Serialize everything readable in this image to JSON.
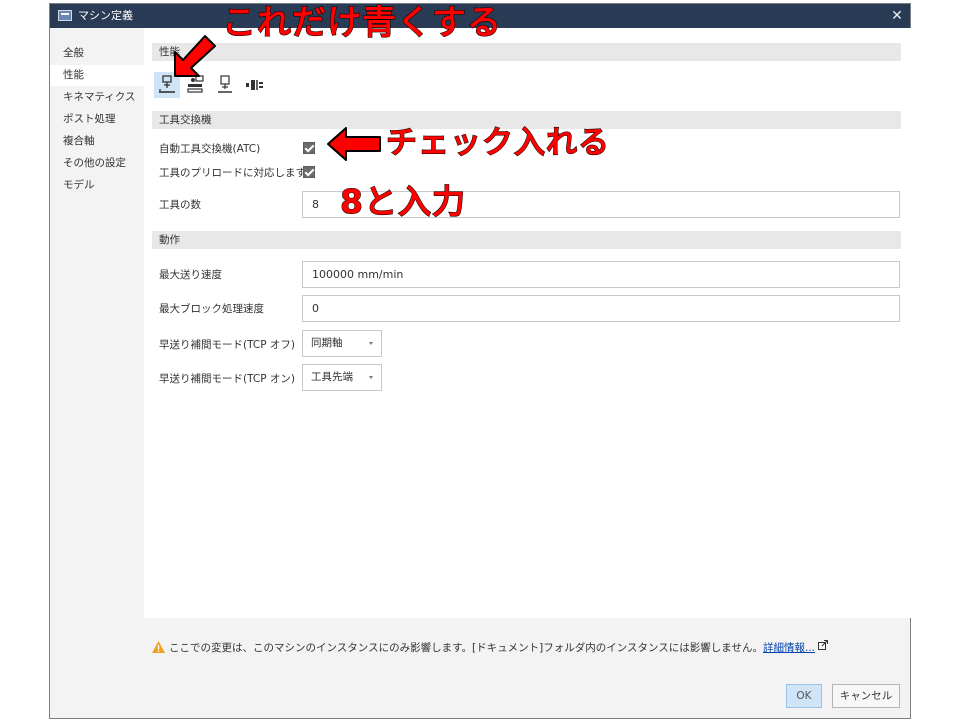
{
  "window": {
    "title": "マシン定義",
    "close_label": "✕"
  },
  "nav": {
    "items": [
      {
        "label": "全般",
        "active": false
      },
      {
        "label": "性能",
        "active": true
      },
      {
        "label": "キネマティクス",
        "active": false
      },
      {
        "label": "ポスト処理",
        "active": false
      },
      {
        "label": "複合軸",
        "active": false
      },
      {
        "label": "その他の設定",
        "active": false
      },
      {
        "label": "モデル",
        "active": false
      }
    ]
  },
  "sections": {
    "performance": "性能",
    "tool_changer": "工具交換機",
    "motion": "動作"
  },
  "icon_tabs": [
    {
      "icon": "tool-changer-icon",
      "selected": true
    },
    {
      "icon": "coolant-icon",
      "selected": false
    },
    {
      "icon": "spindle-icon",
      "selected": false
    },
    {
      "icon": "axis-icon",
      "selected": false
    }
  ],
  "tool_changer": {
    "atc_label": "自動工具交換機(ATC)",
    "atc_checked": true,
    "preload_label": "工具のプリロードに対応します。",
    "preload_checked": true,
    "tool_count_label": "工具の数",
    "tool_count_value": "8"
  },
  "motion": {
    "max_feed_label": "最大送り速度",
    "max_feed_value": "100000 mm/min",
    "max_block_label": "最大ブロック処理速度",
    "max_block_value": "0",
    "rapid_tcp_off_label": "早送り補間モード(TCP オフ)",
    "rapid_tcp_off_value": "同期軸",
    "rapid_tcp_on_label": "早送り補間モード(TCP オン)",
    "rapid_tcp_on_value": "工具先端"
  },
  "footer": {
    "warning_text": "ここでの変更は、このマシンのインスタンスにのみ影響します。[ドキュメント]フォルダ内のインスタンスには影響しません。",
    "link_text": "詳細情報..."
  },
  "buttons": {
    "ok": "OK",
    "cancel": "キャンセル"
  },
  "annotations": {
    "blue_note": "これだけ青くする",
    "check_note": "チェック入れる",
    "input_note": "8と入力"
  },
  "colors": {
    "titlebar": "#2a3b56",
    "selected_tab": "#cfe4f7",
    "annotation": "#ff0000",
    "link": "#0645ad",
    "warning": "#f0a020"
  }
}
